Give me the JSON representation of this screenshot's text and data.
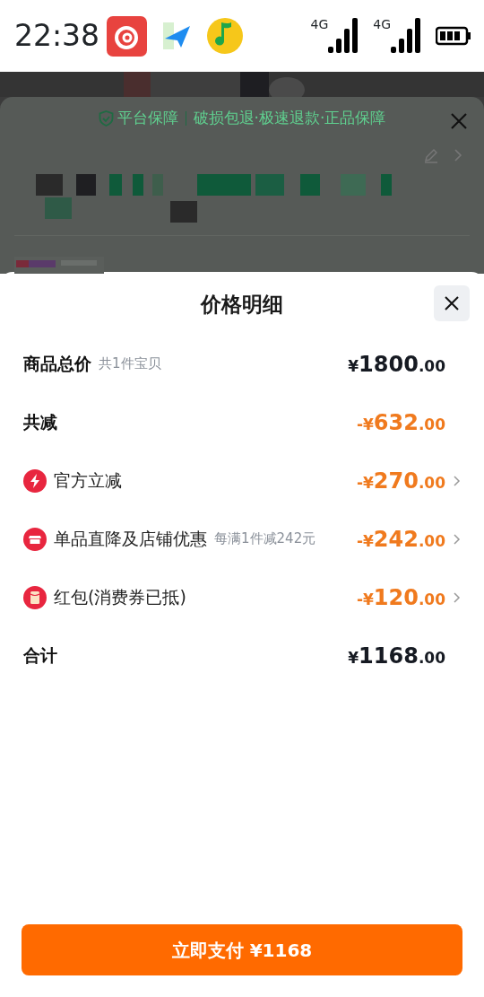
{
  "status_bar": {
    "time": "22:38",
    "networks": [
      "4G",
      "4G"
    ]
  },
  "background": {
    "guarantee_label": "平台保障",
    "guarantee_text": "破损包退·极速退款·正品保障"
  },
  "sheet": {
    "title": "价格明细",
    "rows": [
      {
        "kind": "summary",
        "label": "商品总价",
        "note": "共1件宝贝",
        "amount": "¥1800.00",
        "color": "#161a22"
      },
      {
        "kind": "summary",
        "label": "共减",
        "amount": "-¥632.00",
        "color": "#f07a1e"
      },
      {
        "kind": "discount",
        "label": "官方立减",
        "amount": "-¥270.00",
        "color": "#f07a1e"
      },
      {
        "kind": "discount",
        "label": "单品直降及店铺优惠",
        "note": "每满1件减242元",
        "amount": "-¥242.00",
        "color": "#f07a1e"
      },
      {
        "kind": "discount",
        "label": "红包(消费券已抵)",
        "amount": "-¥120.00",
        "color": "#f07a1e"
      },
      {
        "kind": "summary",
        "label": "合计",
        "amount": "¥1168.00",
        "color": "#161a22"
      }
    ],
    "pay_button": "立即支付 ¥1168"
  }
}
